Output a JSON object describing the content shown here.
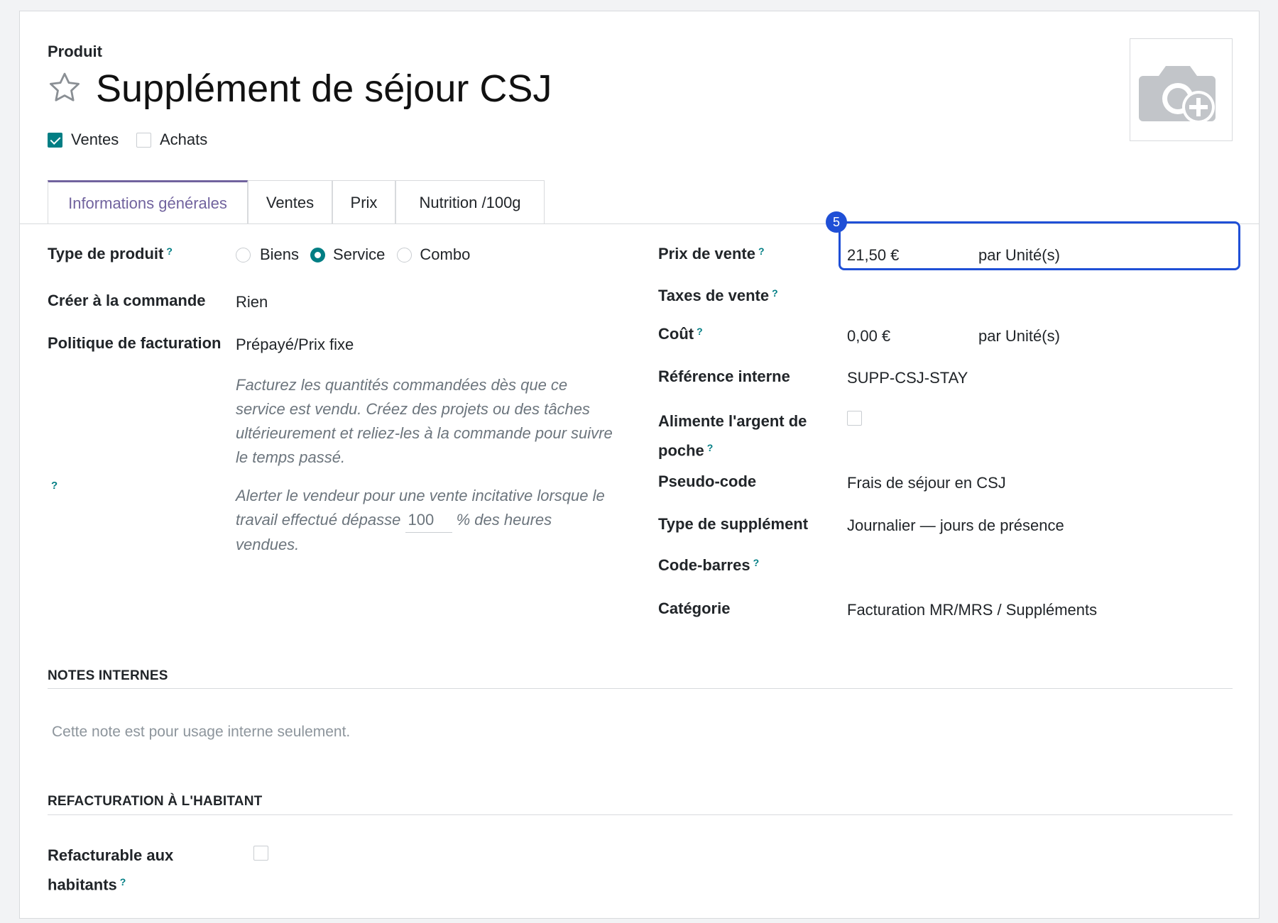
{
  "header": {
    "product_label": "Produit",
    "title": "Supplément de séjour CSJ",
    "favorite_icon": "star-outline-icon",
    "photo_icon": "camera-plus-icon"
  },
  "flags": {
    "sales_label": "Ventes",
    "sales_checked": true,
    "purchase_label": "Achats",
    "purchase_checked": false
  },
  "tabs": [
    {
      "label": "Informations générales",
      "active": true
    },
    {
      "label": "Ventes",
      "active": false
    },
    {
      "label": "Prix",
      "active": false
    },
    {
      "label": "Nutrition /100g",
      "active": false
    }
  ],
  "left": {
    "product_type_label": "Type de produit",
    "product_type_options": [
      "Biens",
      "Service",
      "Combo"
    ],
    "product_type_selected": "Service",
    "create_on_order_label": "Créer à la commande",
    "create_on_order_value": "Rien",
    "invoice_policy_label": "Politique de facturation",
    "invoice_policy_value": "Prépayé/Prix fixe",
    "invoice_help": "Facturez les quantités commandées dès que ce service est vendu. Créez des projets ou des tâches ultérieurement et reliez-les à la commande pour suivre le temps passé.",
    "upsell_help_before": "Alerter le vendeur pour une vente incitative lorsque le travail effectué dépasse",
    "upsell_value": "100",
    "upsell_help_after": "% des heures vendues.",
    "help_mark": "?"
  },
  "right": {
    "sale_price_label": "Prix de vente",
    "sale_price_value": "21,50 €",
    "sale_price_unit": "par Unité(s)",
    "highlight_badge": "5",
    "sale_taxes_label": "Taxes de vente",
    "cost_label": "Coût",
    "cost_value": "0,00 €",
    "cost_unit": "par Unité(s)",
    "internal_ref_label": "Référence interne",
    "internal_ref_value": "SUPP-CSJ-STAY",
    "pocket_money_label": "Alimente l'argent de poche",
    "pocket_money_checked": false,
    "pseudo_code_label": "Pseudo-code",
    "pseudo_code_value": "Frais de séjour en CSJ",
    "supplement_type_label": "Type de supplément",
    "supplement_type_value": "Journalier — jours de présence",
    "barcode_label": "Code-barres",
    "category_label": "Catégorie",
    "category_value": "Facturation MR/MRS / Suppléments"
  },
  "notes": {
    "title": "NOTES INTERNES",
    "placeholder": "Cette note est pour usage interne seulement."
  },
  "rebilling": {
    "title": "REFACTURATION À L'HABITANT",
    "rebillable_label": "Refacturable aux habitants",
    "rebillable_checked": false
  },
  "colors": {
    "accent": "#017e84",
    "tab_active": "#71639e",
    "highlight": "#1f4fd6"
  }
}
